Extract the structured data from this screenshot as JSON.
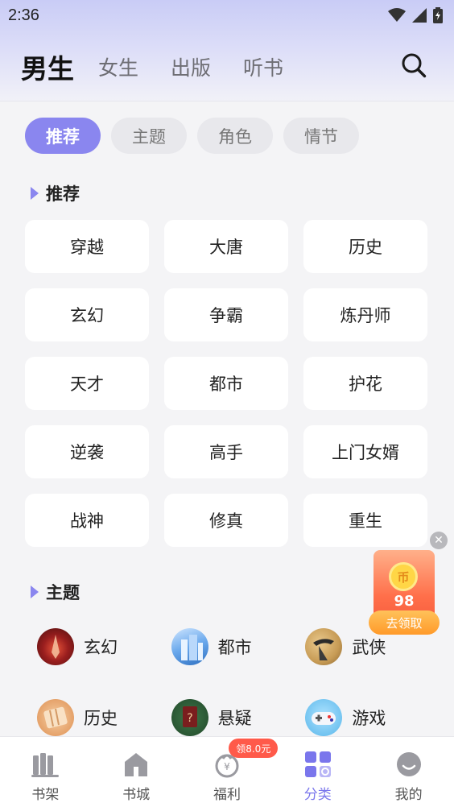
{
  "status": {
    "time": "2:36"
  },
  "header": {
    "tabs": [
      {
        "label": "男生",
        "active": true
      },
      {
        "label": "女生",
        "active": false
      },
      {
        "label": "出版",
        "active": false
      },
      {
        "label": "听书",
        "active": false
      }
    ],
    "search_icon": "search-icon"
  },
  "pills": [
    "推荐",
    "主题",
    "角色",
    "情节"
  ],
  "recommend": {
    "title": "推荐",
    "items": [
      "穿越",
      "大唐",
      "历史",
      "玄幻",
      "争霸",
      "炼丹师",
      "天才",
      "都市",
      "护花",
      "逆袭",
      "高手",
      "上门女婿",
      "战神",
      "修真",
      "重生"
    ]
  },
  "themes": {
    "title": "主题",
    "items": [
      {
        "label": "玄幻",
        "icon": "fantasy-icon"
      },
      {
        "label": "都市",
        "icon": "city-icon"
      },
      {
        "label": "武侠",
        "icon": "martial-arts-icon"
      },
      {
        "label": "历史",
        "icon": "history-icon"
      },
      {
        "label": "悬疑",
        "icon": "mystery-icon"
      },
      {
        "label": "游戏",
        "icon": "game-icon"
      }
    ]
  },
  "float_reward": {
    "amount": "98",
    "button": "去领取",
    "coin_glyph": "币"
  },
  "bottom_nav": {
    "items": [
      {
        "label": "书架",
        "icon": "bookshelf-icon"
      },
      {
        "label": "书城",
        "icon": "bookstore-icon"
      },
      {
        "label": "福利",
        "icon": "welfare-icon",
        "badge": "领8.0元"
      },
      {
        "label": "分类",
        "icon": "category-icon",
        "active": true
      },
      {
        "label": "我的",
        "icon": "profile-icon"
      }
    ]
  },
  "colors": {
    "accent": "#8a86ef",
    "badge": "#ff5a4a"
  }
}
